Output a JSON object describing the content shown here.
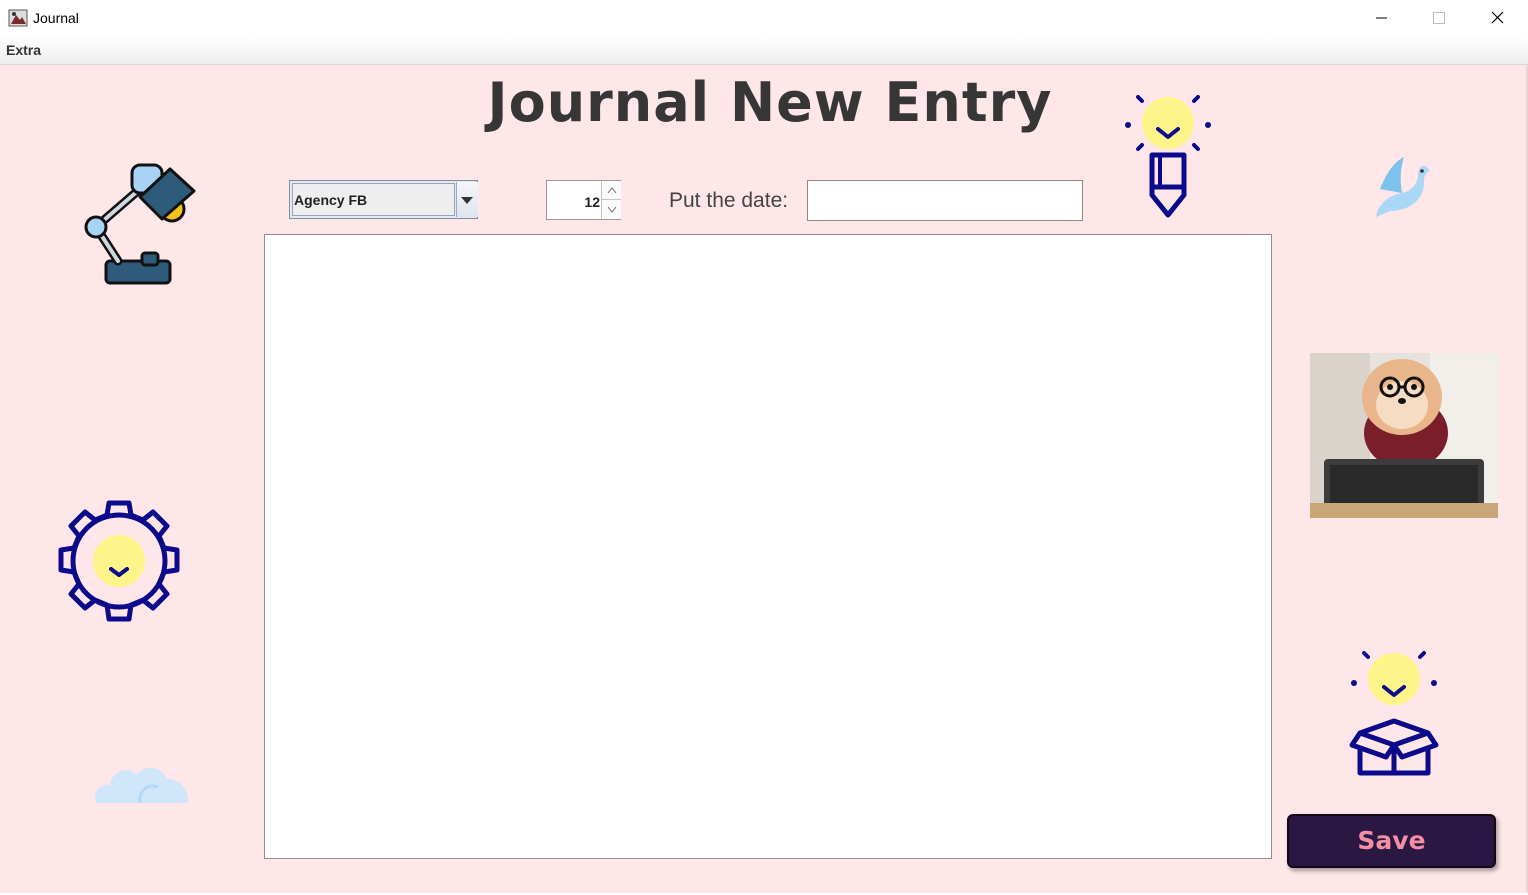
{
  "window": {
    "title": "Journal",
    "controls": [
      "minimize",
      "maximize",
      "close"
    ]
  },
  "menu": {
    "items": [
      "Extra"
    ]
  },
  "page": {
    "title": "Journal New Entry"
  },
  "toolbar": {
    "font_selected": "Agency FB",
    "font_size": "12",
    "date_label": "Put the date:",
    "date_value": ""
  },
  "editor": {
    "text": ""
  },
  "actions": {
    "save_label": "Save"
  },
  "decorations": [
    "desk-lamp-icon",
    "lightbulb-pencil-icon",
    "bird-icon",
    "dog-photo",
    "gear-lightbulb-icon",
    "cloud-icon",
    "lightbulb-box-icon"
  ],
  "colors": {
    "background": "#ffe6e9",
    "title_text": "#363636",
    "save_button_bg": "#2b1842",
    "save_button_text": "#f28fa2",
    "icon_navy": "#0a0a8a",
    "bulb_yellow": "#fff48a"
  }
}
